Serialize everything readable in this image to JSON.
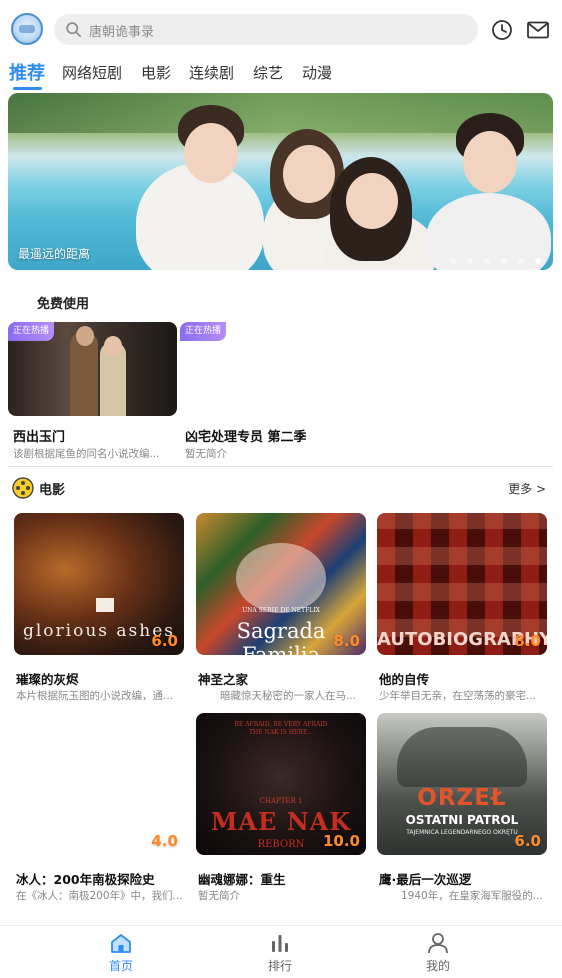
{
  "header": {
    "search_placeholder": "唐朝诡事录",
    "icons": [
      "app-logo",
      "search-icon",
      "history-clock-icon",
      "message-envelope-icon"
    ]
  },
  "tabs": [
    {
      "label": "推荐",
      "active": true
    },
    {
      "label": "网络短剧",
      "active": false
    },
    {
      "label": "电影",
      "active": false
    },
    {
      "label": "连续剧",
      "active": false
    },
    {
      "label": "综艺",
      "active": false
    },
    {
      "label": "动漫",
      "active": false
    }
  ],
  "banner": {
    "caption": "最遥远的距离",
    "slide_count": 6,
    "active_slide": 6
  },
  "free_section": {
    "title": "免费使用",
    "items": [
      {
        "badge": "正在热播",
        "title": "西出玉门",
        "desc": "该剧根据尾鱼的同名小说改编..."
      },
      {
        "badge": "正在热播",
        "title": "凶宅处理专员 第二季",
        "desc": "暂无简介"
      }
    ]
  },
  "movie_section": {
    "title": "电影",
    "more": "更多 >",
    "items": [
      {
        "title": "璀璨的灰烬",
        "desc": "本片根据阮玉图的小说改编，通...",
        "score": "6.0",
        "poster_text": "glorious ashes"
      },
      {
        "title": "神圣之家",
        "desc": "暗藏惊天秘密的一家人在马...",
        "score": "8.0",
        "poster_text": "Sagrada Familia",
        "poster_top": "UNA SERIE DE NETFLIX"
      },
      {
        "title": "他的自传",
        "desc": "少年举目无亲，在空荡荡的豪宅...",
        "score": "8.0",
        "poster_text": "AUTOBIOGRAPHY"
      },
      {
        "title": "冰人：200年南极探险史",
        "desc": "在《冰人：南极200年》中，我们...",
        "score": "4.0",
        "poster_text": ""
      },
      {
        "title": "幽魂娜娜：重生",
        "desc": "暂无简介",
        "score": "10.0",
        "poster_text": "MAE NAK",
        "poster_sub": "REBORN",
        "poster_top": "CHAPTER 1",
        "poster_tag": "BE AFRAID, BE VERY AFRAID\nTHE NAK IS HERE..."
      },
      {
        "title": "鹰·最后一次巡逻",
        "desc": "1940年，在皇家海军服役的...",
        "score": "6.0",
        "poster_text": "ORZEŁ",
        "poster_sub": "OSTATNI PATROL",
        "poster_tag": "TAJEMNICA LEGENDARNEGO OKRĘTU"
      }
    ]
  },
  "bottom_nav": [
    {
      "label": "首页",
      "icon": "home-icon",
      "active": true
    },
    {
      "label": "排行",
      "icon": "ranking-bars-icon",
      "active": false
    },
    {
      "label": "我的",
      "icon": "profile-user-icon",
      "active": false
    }
  ],
  "colors": {
    "accent": "#2f8cf0",
    "score": "#ff8a2a",
    "badge": "#9b7cf4"
  }
}
